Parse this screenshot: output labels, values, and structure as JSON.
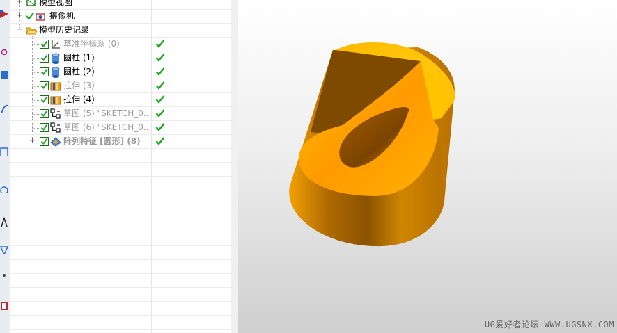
{
  "navigator": {
    "rows": [
      {
        "label": "模型视图"
      },
      {
        "label": "摄像机"
      },
      {
        "label": "模型历史记录"
      },
      {
        "label": "基准坐标系 (0)"
      },
      {
        "label": "圆柱 (1)"
      },
      {
        "label": "圆柱 (2)"
      },
      {
        "label": "拉伸 (3)"
      },
      {
        "label": "拉伸 (4)"
      },
      {
        "label": "草图 (5) \"SKETCH_0..."
      },
      {
        "label": "草图 (6) \"SKETCH_0..."
      },
      {
        "label": "阵列特征 [圆形] (8)"
      }
    ]
  },
  "icons": {
    "model_views": "model-views-icon",
    "cameras": "camera-icon",
    "history": "folder-open-icon",
    "datum_csys": "datum-csys-icon",
    "cylinder": "cylinder-icon",
    "extrude": "extrude-icon",
    "sketch": "sketch-icon",
    "pattern": "pattern-feature-icon",
    "up_to_date": "green-check-icon"
  },
  "colors": {
    "part_light": "#ffc800",
    "part_mid": "#e89a00",
    "part_dark": "#8a5200",
    "check_green": "#1fa51f",
    "disabled_text": "#9a9a9a"
  },
  "graphics": {
    "watermark": "UG爱好者论坛 WWW.UGSNX.COM"
  }
}
